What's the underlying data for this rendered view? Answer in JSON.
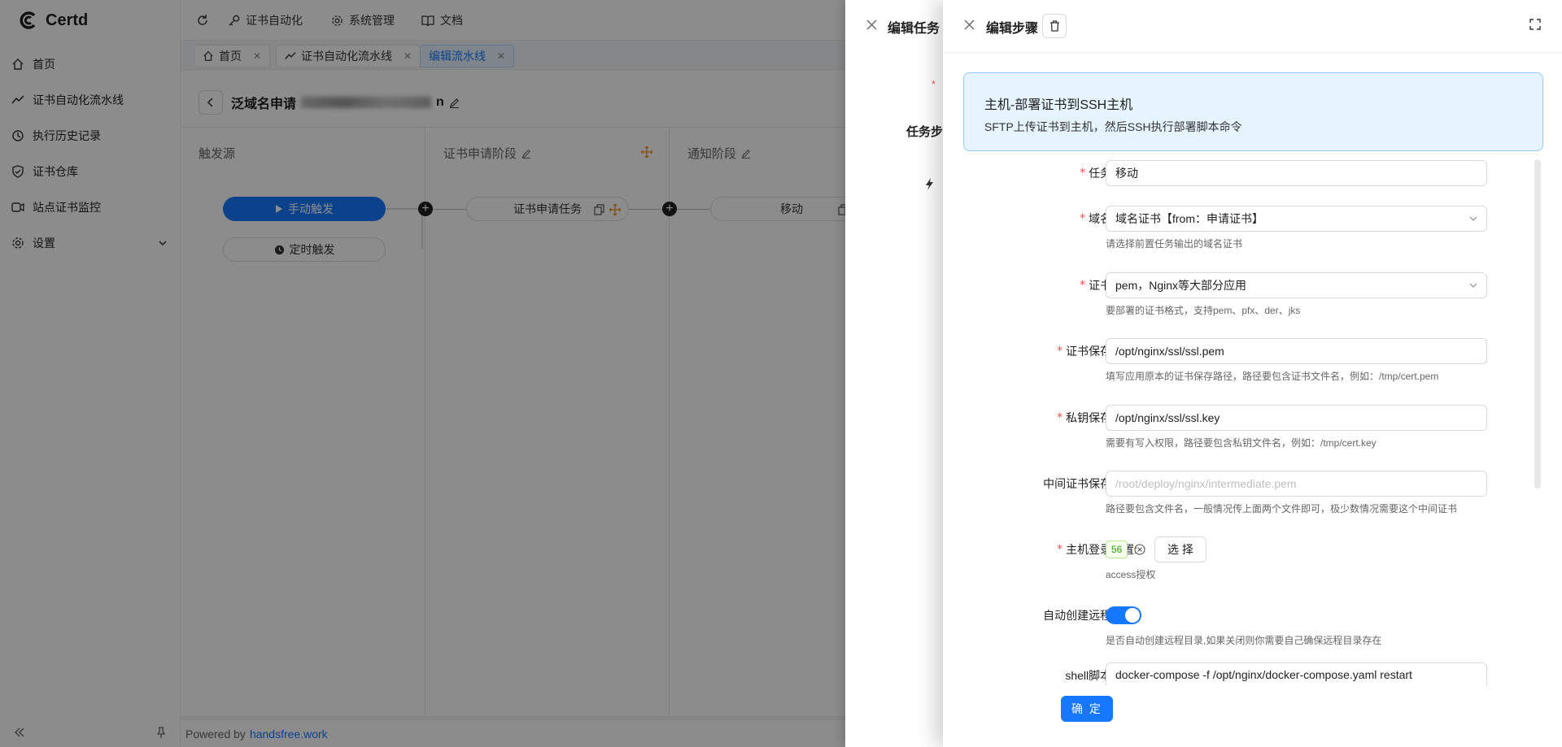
{
  "app": {
    "name": "Certd"
  },
  "sidebar": {
    "items": [
      {
        "label": "首页",
        "icon": "home-icon"
      },
      {
        "label": "证书自动化流水线",
        "icon": "line-chart-icon"
      },
      {
        "label": "执行历史记录",
        "icon": "history-icon"
      },
      {
        "label": "证书仓库",
        "icon": "shield-icon"
      },
      {
        "label": "站点证书监控",
        "icon": "monitor-icon"
      },
      {
        "label": "设置",
        "icon": "gear-icon"
      }
    ]
  },
  "topbar": {
    "items": [
      {
        "label": "证书自动化",
        "icon": "key-icon"
      },
      {
        "label": "系统管理",
        "icon": "gear-icon"
      },
      {
        "label": "文档",
        "icon": "book-icon"
      }
    ]
  },
  "tabs": [
    {
      "label": "首页",
      "active": false
    },
    {
      "label": "证书自动化流水线",
      "active": false
    },
    {
      "label": "编辑流水线",
      "active": true
    }
  ],
  "pipeline": {
    "title": "泛域名申请",
    "title_rest": "n",
    "stages": [
      {
        "title": "触发源"
      },
      {
        "title": "证书申请阶段"
      },
      {
        "title": "通知阶段"
      }
    ],
    "trigger_manual": "手动触发",
    "trigger_timer": "定时触发",
    "cert_task": "证书申请任务",
    "notify_task": "移动"
  },
  "footer": {
    "prefix": "Powered by",
    "link": "handsfree.work"
  },
  "drawer1": {
    "title": "编辑任务",
    "side_label": "任务步",
    "star": "*"
  },
  "drawer2": {
    "title": "编辑步骤",
    "alert": {
      "title": "主机-部署证书到SSH主机",
      "desc": "SFTP上传证书到主机，然后SSH执行部署脚本命令"
    },
    "fields": [
      {
        "label": "任务名称:",
        "required": true,
        "value": "移动",
        "placeholder": "",
        "help": "",
        "type": "input"
      },
      {
        "label": "域名证书:",
        "required": true,
        "value": "域名证书【from：申请证书】",
        "placeholder": "",
        "help": "请选择前置任务输出的域名证书",
        "type": "select"
      },
      {
        "label": "证书格式:",
        "required": true,
        "value": "pem，Nginx等大部分应用",
        "placeholder": "",
        "help": "要部署的证书格式，支持pem、pfx、der、jks",
        "type": "select"
      },
      {
        "label": "证书保存路径:",
        "required": true,
        "value": "/opt/nginx/ssl/ssl.pem",
        "placeholder": "",
        "help": "填写应用原本的证书保存路径，路径要包含证书文件名，例如：/tmp/cert.pem",
        "type": "input"
      },
      {
        "label": "私钥保存路径:",
        "required": true,
        "value": "/opt/nginx/ssl/ssl.key",
        "placeholder": "",
        "help": "需要有写入权限，路径要包含私钥文件名，例如：/tmp/cert.key",
        "type": "input"
      },
      {
        "label": "中间证书保存路径:",
        "required": false,
        "value": "",
        "placeholder": "/root/deploy/nginx/intermediate.pem",
        "help": "路径要包含文件名，一般情况传上面两个文件即可，极少数情况需要这个中间证书",
        "type": "input"
      },
      {
        "label": "主机登录配置:",
        "required": true,
        "value": "56",
        "select_label": "选 择",
        "help": "access授权",
        "type": "access"
      },
      {
        "label": "自动创建远程目录:",
        "required": false,
        "value": "on",
        "help": "是否自动创建远程目录,如果关闭则你需要自己确保远程目录存在",
        "type": "switch"
      },
      {
        "label": "shell脚本命令:",
        "required": false,
        "value": "docker-compose  -f /opt/nginx/docker-compose.yaml  restart",
        "placeholder": "",
        "help": "",
        "type": "input"
      }
    ],
    "ok_label": "确 定"
  },
  "colors": {
    "primary": "#1677ff",
    "danger": "#ff4d4f",
    "alert_bg": "#e6f4ff",
    "alert_border": "#91caff",
    "tag_green": "#52c41a"
  }
}
